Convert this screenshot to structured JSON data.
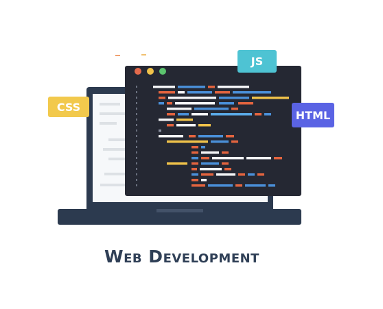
{
  "tags": {
    "js": "JS",
    "css": "CSS",
    "html": "HTML"
  },
  "caption": "Web Development",
  "colors": {
    "js_tag": "#4ec3d3",
    "css_tag": "#f2c94c",
    "html_tag": "#5a63e4",
    "window_bg": "#252833",
    "laptop": "#2c3a4f",
    "dot_red": "#e46a4c",
    "dot_yellow": "#f0c24a",
    "dot_green": "#5cc46f"
  }
}
